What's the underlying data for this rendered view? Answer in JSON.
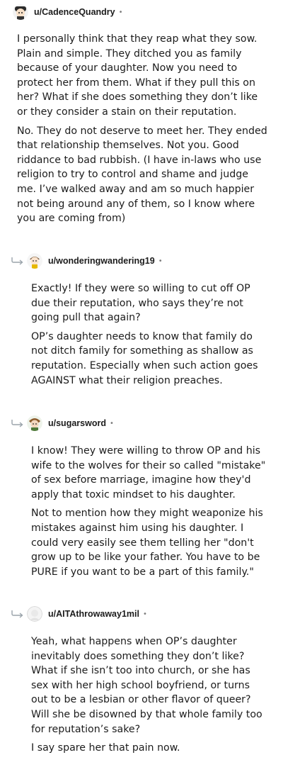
{
  "thread": {
    "comments": [
      {
        "username": "u/CadenceQuandry",
        "dot": "•",
        "paragraphs": [
          "I personally think that they reap what they sow. Plain and simple. They ditched you as family because of your daughter. Now you need to protect her from them. What if they pull this on her? What if she does something they don’t like or they consider a stain on their reputation.",
          "No. They do not deserve to meet her. They ended that relationship themselves. Not you. Good riddance to bad rubbish. (I have in-laws who use religion to try to control and shame and judge me. I’ve walked away and am so much happier not being around any of them, so I know where you are coming from)"
        ]
      },
      {
        "username": "u/wonderingwandering19",
        "dot": "•",
        "paragraphs": [
          "Exactly! If they were so willing to cut off OP due their reputation, who says they’re not going pull that again?",
          "OP’s daughter needs to know that family do not ditch family for something as shallow as reputation. Especially when such action goes AGAINST what their religion preaches."
        ]
      },
      {
        "username": "u/sugarsword",
        "dot": "•",
        "paragraphs": [
          "I know! They were willing to throw OP and his wife to the wolves for their so called \"mistake\" of sex before marriage, imagine how they'd apply that toxic mindset to his daughter.",
          "Not to mention how they might weaponize his mistakes against him using his daughter. I could very easily see them telling her \"don't grow up to be like your father. You have to be PURE if you want to be a part of this family.\""
        ]
      },
      {
        "username": "u/AITAthrowaway1mil",
        "dot": "•",
        "paragraphs": [
          "Yeah, what happens when OP’s daughter inevitably does something they don’t like? What if she isn’t too into church, or she has sex with her high school boyfriend, or turns out to be a lesbian or other flavor of queer? Will she be disowned by that whole family too for reputation’s sake?",
          "I say spare her that pain now."
        ]
      }
    ]
  },
  "colors": {
    "text": "#1c1c1c",
    "meta": "#7c7c7c",
    "reply_arrow": "#9aa3aa"
  },
  "icons": {
    "reply": "reply-arrow-icon",
    "avatar": "snoo-avatar-icon"
  }
}
